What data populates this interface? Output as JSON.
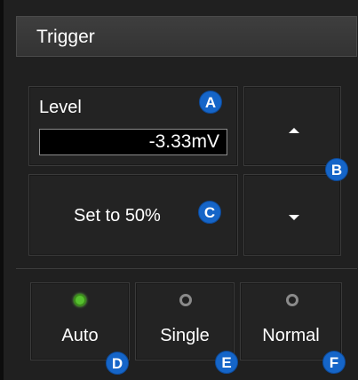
{
  "panel": {
    "title": "Trigger"
  },
  "level": {
    "label": "Level",
    "value": "-3.33mV"
  },
  "buttons": {
    "up_icon": "arrow-up-icon",
    "down_icon": "arrow-down-icon",
    "set50_label": "Set to 50%"
  },
  "modes": [
    {
      "label": "Auto",
      "selected": true
    },
    {
      "label": "Single",
      "selected": false
    },
    {
      "label": "Normal",
      "selected": false
    }
  ],
  "callouts": {
    "a": "A",
    "b": "B",
    "c": "C",
    "d": "D",
    "e": "E",
    "f": "F"
  },
  "colors": {
    "callout": "#1565c8",
    "radio_on": "#56c02e",
    "radio_off": "#8a8a8a",
    "panel_bg": "#202020"
  }
}
